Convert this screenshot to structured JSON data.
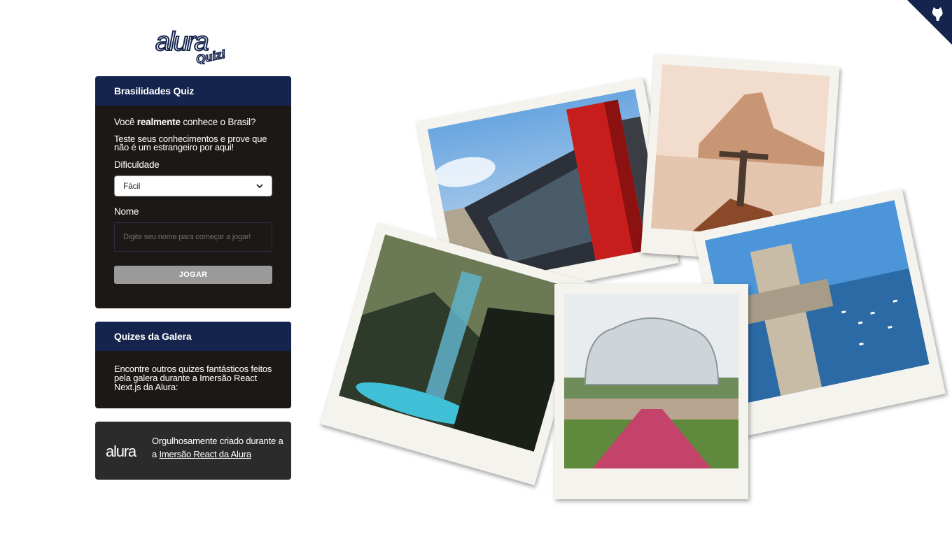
{
  "logo": {
    "word": "alura",
    "sub": "Quiz!"
  },
  "quiz_card": {
    "title": "Brasilidades Quiz",
    "question_prefix": "Você ",
    "question_bold": "realmente",
    "question_suffix": " conhece o Brasil?",
    "description": "Teste seus conhecimentos e prove que não é um estrangeiro por aqui!",
    "difficulty_label": "Dificuldade",
    "difficulty_value": "Fácil",
    "name_label": "Nome",
    "name_placeholder": "Digite seu nome para começar a jogar!",
    "play_button": "JOGAR"
  },
  "galera_card": {
    "title": "Quizes da Galera",
    "description": "Encontre outros quizes fantásticos feitos pela galera durante a Imersão React Next.js da Alura:"
  },
  "footer": {
    "logo_text": "alura",
    "text": "Orgulhosamente criado durante a ",
    "link": "Imersão React da Alura"
  },
  "colors": {
    "card_header": "#15244d",
    "card_body": "#1c1815",
    "button_disabled": "#9a9a9a",
    "footer_bg": "#2b2b2b",
    "corner": "#15244d"
  },
  "icons": [
    "chevron-down-icon",
    "github-cat-icon"
  ]
}
